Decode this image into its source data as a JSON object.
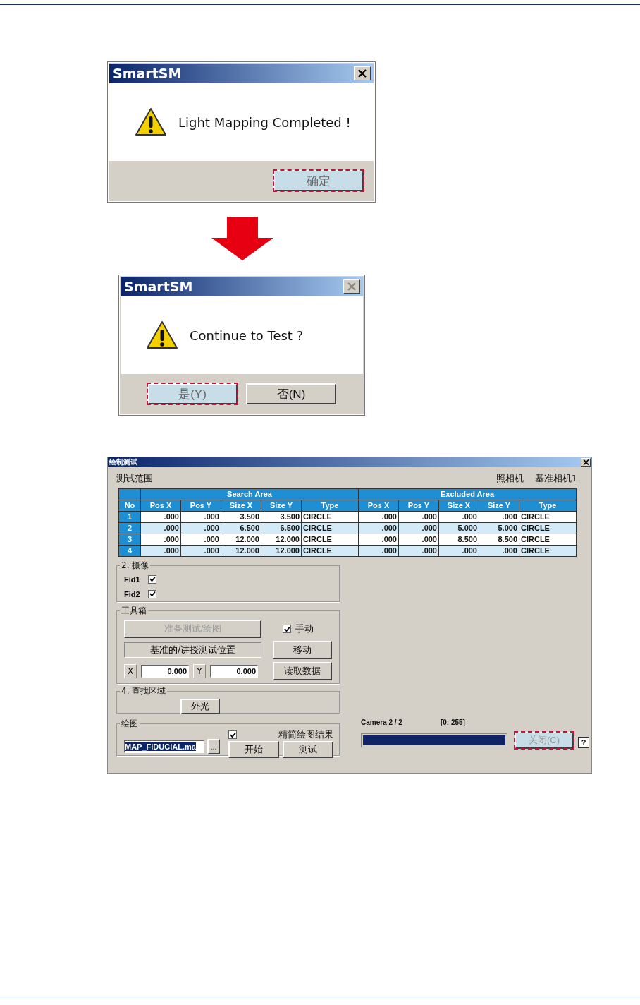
{
  "dialogs": [
    {
      "title": "SmartSM",
      "close_disabled": false,
      "message": "Light Mapping Completed !",
      "buttons": [
        {
          "label": "确定",
          "focused": true
        }
      ]
    },
    {
      "title": "SmartSM",
      "close_disabled": true,
      "message": "Continue to Test ?",
      "buttons": [
        {
          "label": "是(Y)",
          "focused": true
        },
        {
          "label": "否(N)",
          "focused": false
        }
      ]
    }
  ],
  "map_dialog": {
    "title": "绘制测试",
    "section_title": "测试范围",
    "camera_label": "照相机",
    "camera_value": "基准相机1",
    "table": {
      "groups": [
        "Search Area",
        "Excluded Area"
      ],
      "columns": [
        "No",
        "Pos X",
        "Pos Y",
        "Size X",
        "Size Y",
        "Type",
        "Pos X",
        "Pos Y",
        "Size X",
        "Size Y",
        "Type"
      ],
      "rows": [
        {
          "cells": [
            "1",
            ".000",
            ".000",
            "3.500",
            "3.500",
            "CIRCLE",
            ".000",
            ".000",
            ".000",
            ".000",
            "CIRCLE"
          ]
        },
        {
          "cells": [
            "2",
            ".000",
            ".000",
            "6.500",
            "6.500",
            "CIRCLE",
            ".000",
            ".000",
            "5.000",
            "5.000",
            "CIRCLE"
          ]
        },
        {
          "cells": [
            "3",
            ".000",
            ".000",
            "12.000",
            "12.000",
            "CIRCLE",
            ".000",
            ".000",
            "8.500",
            "8.500",
            "CIRCLE"
          ]
        },
        {
          "cells": [
            "4",
            ".000",
            ".000",
            "12.000",
            "12.000",
            "CIRCLE",
            ".000",
            ".000",
            ".000",
            ".000",
            "CIRCLE"
          ]
        }
      ]
    },
    "fid_group": {
      "title": "2. 摄像",
      "items": [
        {
          "label": "Fid1",
          "checked": true
        },
        {
          "label": "Fid2",
          "checked": true
        }
      ]
    },
    "toolbox": {
      "title": "工具箱",
      "prepare_button": {
        "label": "准备测试/绘图",
        "disabled": true
      },
      "manual": {
        "label": "手动",
        "checked": true
      },
      "position_label": "基准的/讲授测试位置",
      "move_button": "移动",
      "x_label": "X",
      "x_value": "0.000",
      "y_label": "Y",
      "y_value": "0.000",
      "read_button": "读取数据"
    },
    "search_group": {
      "title": "4. 查找区域",
      "button": "外光"
    },
    "map_group": {
      "title": "绘图",
      "file": "MAP_FIDUCIAL.ma",
      "browse_button": "...",
      "simplify": {
        "label": "精简绘图结果",
        "checked": true
      },
      "start_button": "开始",
      "test_button": "测试"
    },
    "status": {
      "camera": "Camera 2 / 2",
      "range": "[0:  255]",
      "level": 1,
      "close_button": {
        "label": "关闭(C)",
        "focused": true,
        "disabled": true
      },
      "help_button": "?"
    }
  }
}
